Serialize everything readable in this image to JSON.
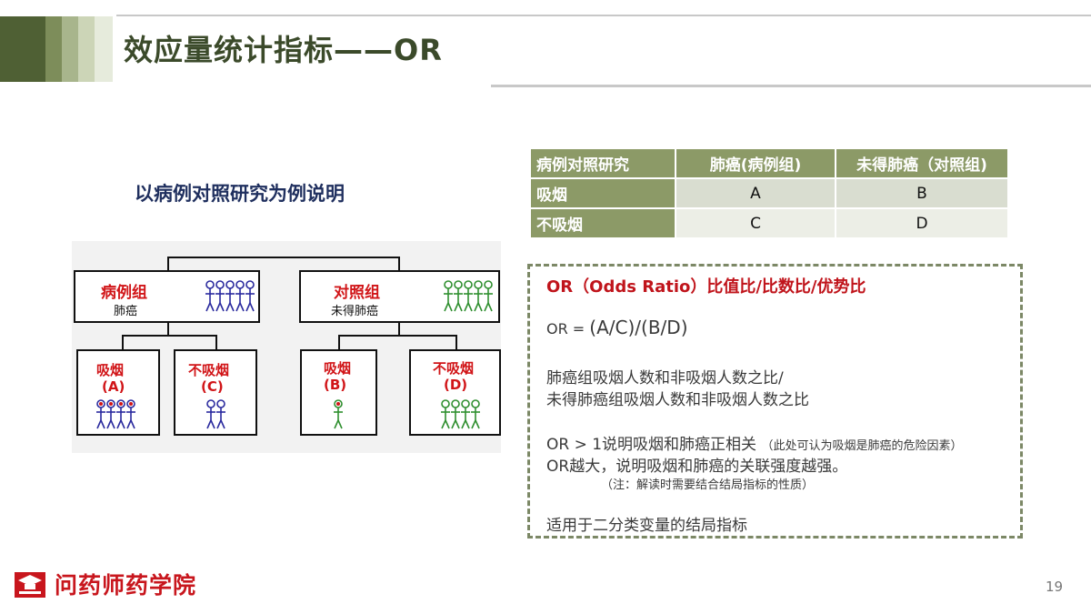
{
  "slide": {
    "title": "效应量统计指标——OR",
    "subtitle": "以病例对照研究为例说明",
    "page_number": "19",
    "brand": "问药师药学院"
  },
  "table": {
    "header": [
      "病例对照研究",
      "肺癌(病例组)",
      "未得肺癌（对照组)"
    ],
    "rows": [
      {
        "label": "吸烟",
        "c1": "A",
        "c2": "B"
      },
      {
        "label": "不吸烟",
        "c1": "C",
        "c2": "D"
      }
    ]
  },
  "diagram": {
    "case_group": {
      "title": "病例组",
      "sub": "肺癌"
    },
    "control_group": {
      "title": "对照组",
      "sub": "未得肺癌"
    },
    "a": {
      "t1": "吸烟",
      "t2": "(A)"
    },
    "c": {
      "t1": "不吸烟",
      "t2": "(C)"
    },
    "b": {
      "t1": "吸烟",
      "t2": "(B)"
    },
    "d": {
      "t1": "不吸烟",
      "t2": "(D)"
    }
  },
  "or_box": {
    "title": "OR（Odds Ratio）比值比/比数比/优势比",
    "formula_prefix": "OR = ",
    "formula": "(A/C)/(B/D)",
    "desc1": "肺癌组吸烟人数和非吸烟人数之比/",
    "desc2": "未得肺癌组吸烟人数和非吸烟人数之比",
    "rule1": "OR > 1说明吸烟和肺癌正相关",
    "rule1_note": "（此处可认为吸烟是肺癌的危险因素）",
    "rule2": "OR越大，说明吸烟和肺癌的关联强度越强。",
    "note": "（注：解读时需要结合结局指标的性质）",
    "applies": "适用于二分类变量的结局指标"
  },
  "colors": {
    "accent_green": "#8c9a67",
    "title_dark": "#3b4a2a",
    "red": "#c0141b",
    "blue_figure": "#2a2a9e",
    "green_figure": "#2f8f2f"
  }
}
